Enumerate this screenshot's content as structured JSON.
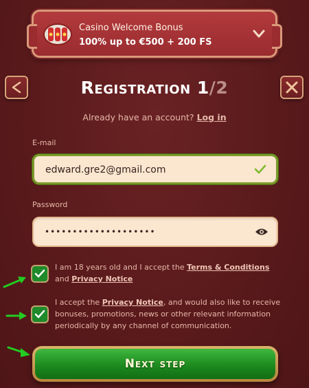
{
  "bonus": {
    "title": "Casino Welcome Bonus",
    "subtitle": "100% up to €500 + 200 FS"
  },
  "header": {
    "title": "Registration",
    "step_current": "1",
    "step_total": "/2"
  },
  "login": {
    "prompt": "Already have an account?",
    "link": "Log in"
  },
  "form": {
    "email_label": "E-mail",
    "email_value": "edward.gre2@gmail.com",
    "password_label": "Password",
    "password_value": "••••••••••••••••••••"
  },
  "consent1": {
    "text_a": "I am 18 years old and I accept the ",
    "terms_link": "Terms & Conditions",
    "text_b": " and ",
    "privacy_link": "Privacy Notice"
  },
  "consent2": {
    "text_a": "I accept the ",
    "privacy_link": "Privacy Notice",
    "text_b": ", and would also like to receive bonuses, promotions, news or other relevant information periodically by any channel of communication."
  },
  "next_button": "Next step",
  "colors": {
    "background": "#5a1a1c",
    "accent_green": "#1f8a2a",
    "field_bg": "#fbe6d0",
    "border_gold": "#d8a47c",
    "arrow_green": "#22cc22"
  }
}
